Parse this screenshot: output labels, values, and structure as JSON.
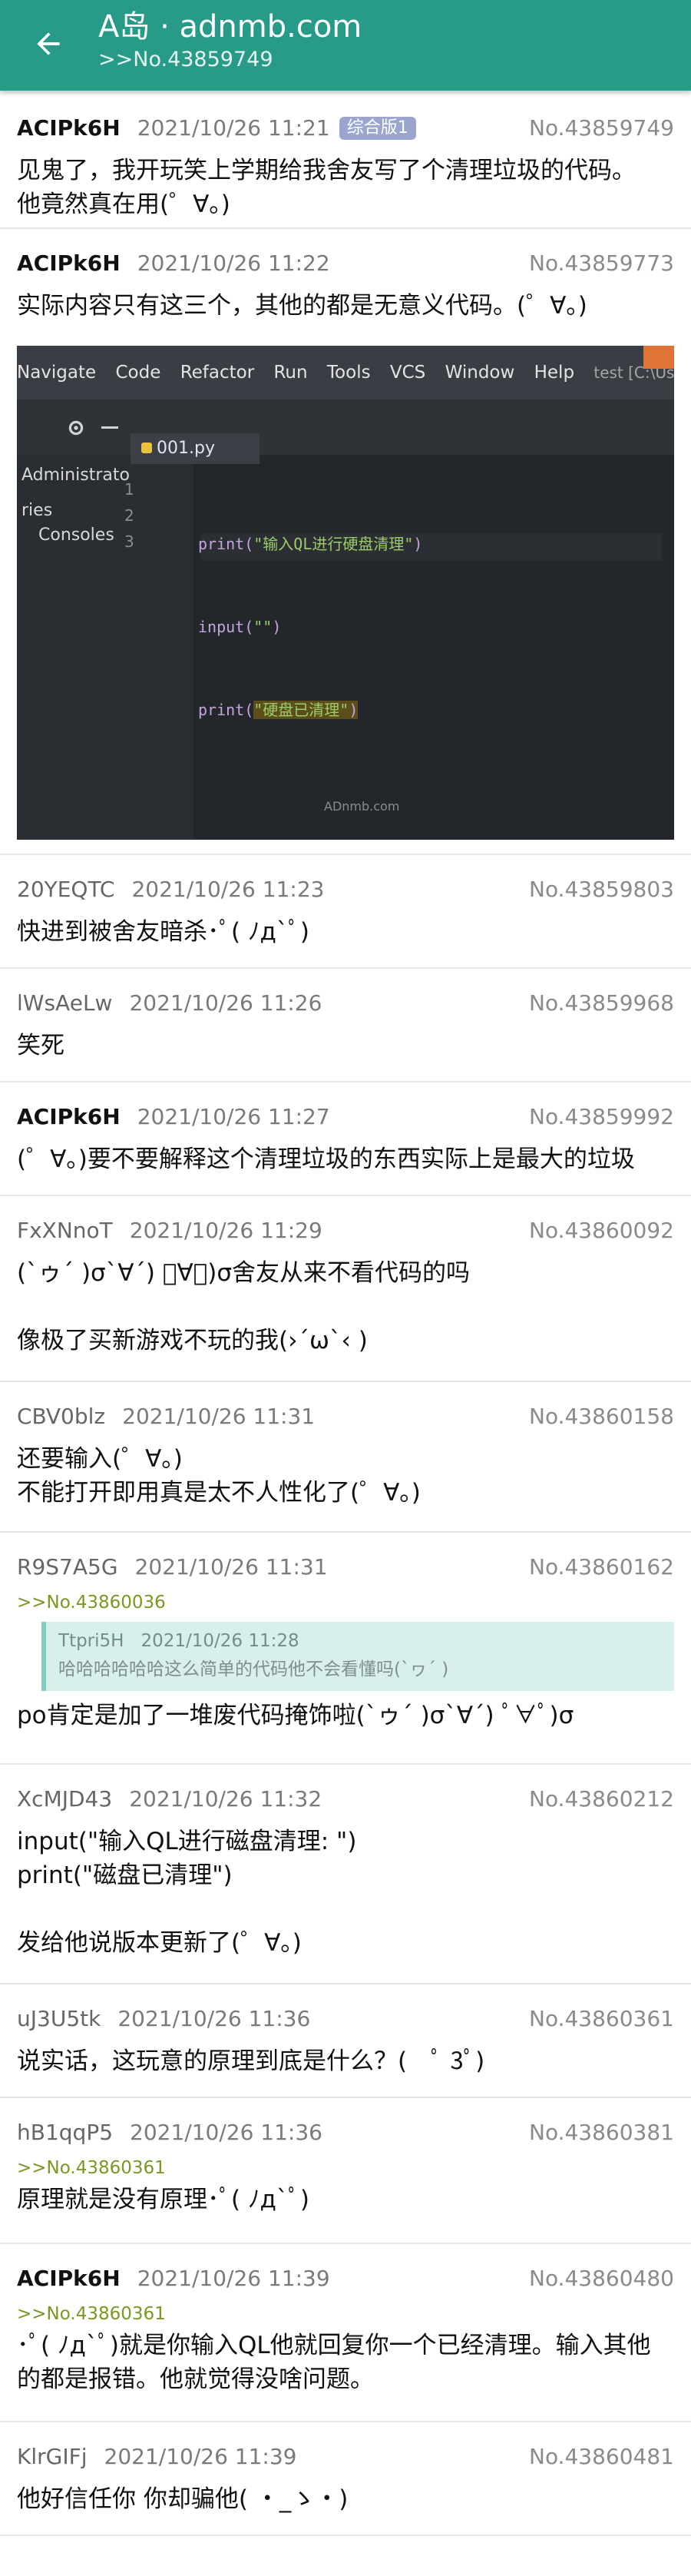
{
  "appbar": {
    "title": "A岛 · adnmb.com",
    "subtitle": ">>No.43859749"
  },
  "posts": [
    {
      "uid": "ACIPk6H",
      "time": "2021/10/26 11:21",
      "no": "No.43859749",
      "badge": "综合版1",
      "lines": [
        "见鬼了，我开玩笑上学期给我舍友写了个清理垃圾的代码。",
        "他竟然真在用(゜∀。)"
      ]
    },
    {
      "uid": "ACIPk6H",
      "time": "2021/10/26 11:22",
      "no": "No.43859773",
      "lines": [
        "实际内容只有这三个，其他的都是无意义代码。(゜∀。)"
      ]
    },
    {
      "uid": "20YEQTC",
      "time": "2021/10/26 11:23",
      "no": "No.43859803",
      "lines": [
        "快进到被舍友暗杀･ﾟ( ﾉд`ﾟ)"
      ]
    },
    {
      "uid": "lWsAeLw",
      "time": "2021/10/26 11:26",
      "no": "No.43859968",
      "lines": [
        "笑死"
      ]
    },
    {
      "uid": "ACIPk6H",
      "time": "2021/10/26 11:27",
      "no": "No.43859992",
      "lines": [
        "(゜∀。)要不要解释这个清理垃圾的东西实际上是最大的垃圾"
      ]
    },
    {
      "uid": "FxXNnoT",
      "time": "2021/10/26 11:29",
      "no": "No.43860092",
      "lines": [
        "(`ゥ´ )σ`∀´) ﾟ∀ﾟ)σ舍友从来不看代码的吗",
        "像极了买新游戏不玩的我(›´ω`‹ )"
      ]
    },
    {
      "uid": "CBV0blz",
      "time": "2021/10/26 11:31",
      "no": "No.43860158",
      "lines": [
        "还要输入(゜∀。)",
        "不能打开即用真是太不人性化了(゜∀。)"
      ]
    },
    {
      "uid": "R9S7A5G",
      "time": "2021/10/26 11:31",
      "no": "No.43860162",
      "ref": ">>No.43860036",
      "quote": {
        "uid": "Ttpri5H",
        "time": "2021/10/26 11:28",
        "text": "哈哈哈哈哈哈这么简单的代码他不会看懂吗(`ヮ´ )"
      },
      "lines": [
        "po肯定是加了一堆废代码掩饰啦(`ゥ´ )σ`∀´) ﾟ∀ﾟ)σ"
      ]
    },
    {
      "uid": "XcMJD43",
      "time": "2021/10/26 11:32",
      "no": "No.43860212",
      "lines": [
        "input(\"输入QL进行磁盘清理: \")",
        "print(\"磁盘已清理\")",
        "发给他说版本更新了(゜∀。)"
      ]
    },
    {
      "uid": "uJ3U5tk",
      "time": "2021/10/26 11:36",
      "no": "No.43860361",
      "lines": [
        "说实话，这玩意的原理到底是什么？(　ﾟ 3ﾟ)"
      ]
    },
    {
      "uid": "hB1qqP5",
      "time": "2021/10/26 11:36",
      "no": "No.43860381",
      "ref": ">>No.43860361",
      "lines": [
        "原理就是没有原理･ﾟ( ﾉд`ﾟ)"
      ]
    },
    {
      "uid": "ACIPk6H",
      "time": "2021/10/26 11:39",
      "no": "No.43860480",
      "ref": ">>No.43860361",
      "lines": [
        "･ﾟ( ﾉд`ﾟ)就是你输入QL他就回复你一个已经清理。输入其他的都是报错。他就觉得没啥问题。"
      ]
    },
    {
      "uid": "KlrGIFj",
      "time": "2021/10/26 11:39",
      "no": "No.43860481",
      "lines": [
        "他好信任你 你却骗他( ・_ゝ・)"
      ]
    }
  ],
  "photo": {
    "menu": [
      "Navigate",
      "Code",
      "Refactor",
      "Run",
      "Tools",
      "VCS",
      "Window",
      "Help"
    ],
    "window_title": "test [C:\\Users\\Adm",
    "tab": "001.py",
    "sidebar_items": [
      "Administrato",
      "ries",
      "Consoles"
    ],
    "line_numbers": [
      "1",
      "2",
      "3"
    ],
    "code_lines": [
      {
        "fn": "print(",
        "arg": "\"输入QL进行硬盘清理\"",
        "end": ")"
      },
      {
        "fn": "input(",
        "arg": "\"\"",
        "end": ")"
      },
      {
        "fn": "print(",
        "arg": "\"硬盘已清理\"",
        "end": ")"
      }
    ],
    "watermark": "ADnmb.com"
  }
}
